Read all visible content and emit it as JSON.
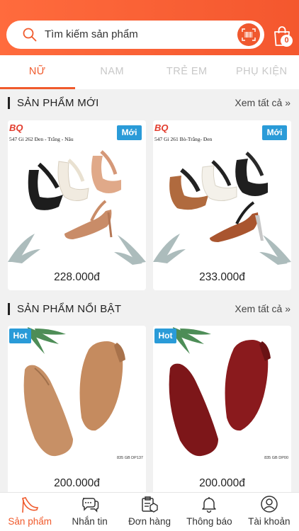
{
  "search": {
    "placeholder": "Tìm kiếm sản phẩm"
  },
  "cart": {
    "count": "0"
  },
  "tabs": [
    {
      "label": "NỮ",
      "active": true
    },
    {
      "label": "NAM"
    },
    {
      "label": "TRẺ EM"
    },
    {
      "label": "PHỤ KIỆN"
    }
  ],
  "sections": {
    "new": {
      "title": "SẢN PHẨM MỚI",
      "see_all": "Xem tất cả »"
    },
    "featured": {
      "title": "SẢN PHẨM NỔI BẬT",
      "see_all": "Xem tất cả »"
    }
  },
  "products_new": [
    {
      "brand": "BQ",
      "model": "547 Gi 262  Đen - Trắng - Nâu",
      "badge": "Mới",
      "price": "228.000đ"
    },
    {
      "brand": "BQ",
      "model": "547 Gi 261 Bò-Trắng- Đen",
      "badge": "Mới",
      "price": "233.000đ"
    }
  ],
  "products_featured": [
    {
      "badge": "Hot",
      "code": "835 GB DP137",
      "price": "200.000đ"
    },
    {
      "badge": "Hot",
      "code": "835 GB DP00",
      "price": "200.000đ"
    }
  ],
  "bottom_nav": [
    {
      "label": "Sản phẩm",
      "icon": "heel-icon",
      "active": true
    },
    {
      "label": "Nhắn tin",
      "icon": "chat-icon"
    },
    {
      "label": "Đơn hàng",
      "icon": "orders-icon"
    },
    {
      "label": "Thông báo",
      "icon": "bell-icon"
    },
    {
      "label": "Tài khoản",
      "icon": "account-icon"
    }
  ],
  "colors": {
    "accent": "#f05a2c",
    "badge": "#2a9bd8"
  }
}
